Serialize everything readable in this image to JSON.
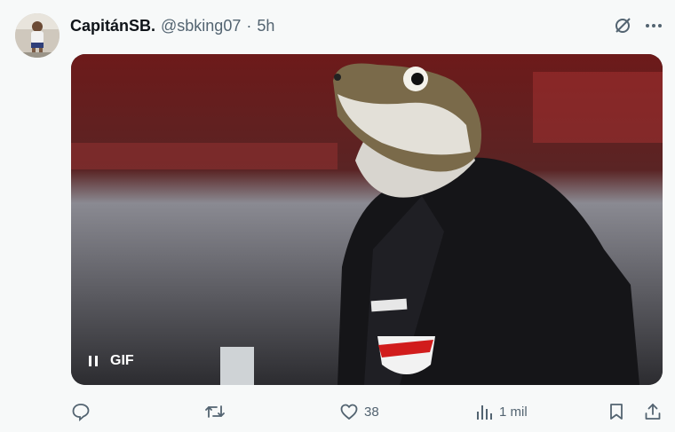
{
  "tweet": {
    "display_name": "CapitánSB.",
    "handle": "@sbking07",
    "separator": "·",
    "time": "5h",
    "icons": [
      "grok-icon",
      "more-icon"
    ]
  },
  "media": {
    "badge": "GIF",
    "controls": [
      "pause-icon"
    ]
  },
  "actions": {
    "reply_count": "",
    "retweet_count": "",
    "like_count": "38",
    "views_count": "1 mil",
    "icons": [
      "reply-icon",
      "retweet-icon",
      "like-icon",
      "views-icon",
      "bookmark-icon",
      "share-icon"
    ]
  },
  "colors": {
    "background": "#f7f9f9",
    "text_primary": "#0f1419",
    "text_secondary": "#536471"
  }
}
